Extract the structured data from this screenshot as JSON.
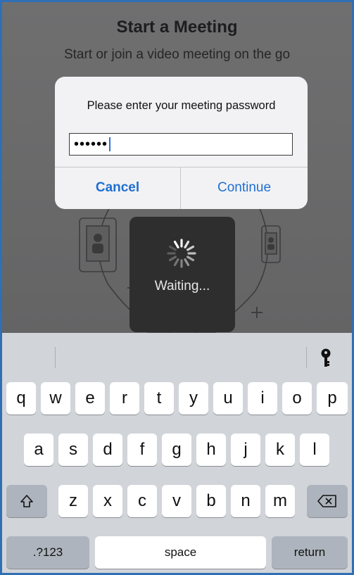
{
  "app": {
    "title": "Start a Meeting",
    "subtitle": "Start or join a video meeting on the go"
  },
  "alert": {
    "message": "Please enter your meeting password",
    "password_masked": "••••••",
    "cancel_label": "Cancel",
    "continue_label": "Continue"
  },
  "hud": {
    "label": "Waiting..."
  },
  "keyboard": {
    "row1": [
      "q",
      "w",
      "e",
      "r",
      "t",
      "y",
      "u",
      "i",
      "o",
      "p"
    ],
    "row2": [
      "a",
      "s",
      "d",
      "f",
      "g",
      "h",
      "j",
      "k",
      "l"
    ],
    "row3": [
      "z",
      "x",
      "c",
      "v",
      "b",
      "n",
      "m"
    ],
    "numbers_label": ".?123",
    "space_label": "space",
    "return_label": "return",
    "shift_icon": "shift-icon",
    "backspace_icon": "backspace-icon",
    "password_key_icon": "key-icon"
  },
  "colors": {
    "accent": "#1f6fd1",
    "dim_overlay": "#6b6b6c",
    "keyboard_bg": "#d1d4d9",
    "hud_bg": "#2e2e2f"
  }
}
